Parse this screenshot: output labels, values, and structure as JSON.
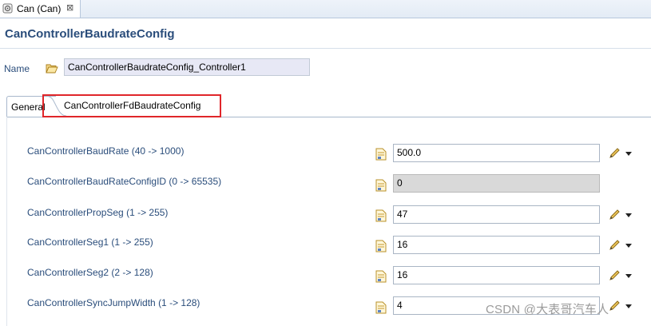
{
  "editor_tab": {
    "label": "Can (Can)",
    "close": "⊠"
  },
  "page_title": "CanControllerBaudrateConfig",
  "name_row": {
    "label": "Name",
    "value": "CanControllerBaudrateConfig_Controller1"
  },
  "inner_tabs": [
    {
      "label": "General",
      "selected": true
    },
    {
      "label": "CanControllerFdBaudrateConfig",
      "selected": false,
      "highlighted": true
    }
  ],
  "params": [
    {
      "label": "CanControllerBaudRate (40 -> 1000)",
      "value": "500.0",
      "editable": true
    },
    {
      "label": "CanControllerBaudRateConfigID (0 -> 65535)",
      "value": "0",
      "editable": false
    },
    {
      "label": "CanControllerPropSeg (1 -> 255)",
      "value": "47",
      "editable": true
    },
    {
      "label": "CanControllerSeg1 (1 -> 255)",
      "value": "16",
      "editable": true
    },
    {
      "label": "CanControllerSeg2 (2 -> 128)",
      "value": "16",
      "editable": true
    },
    {
      "label": "CanControllerSyncJumpWidth (1 -> 128)",
      "value": "4",
      "editable": true
    }
  ],
  "watermark": "CSDN @大表哥汽车人",
  "colors": {
    "label_blue": "#2a4d7b",
    "highlight_red": "#e0262a",
    "readonly_gray": "#d9d9d9"
  }
}
